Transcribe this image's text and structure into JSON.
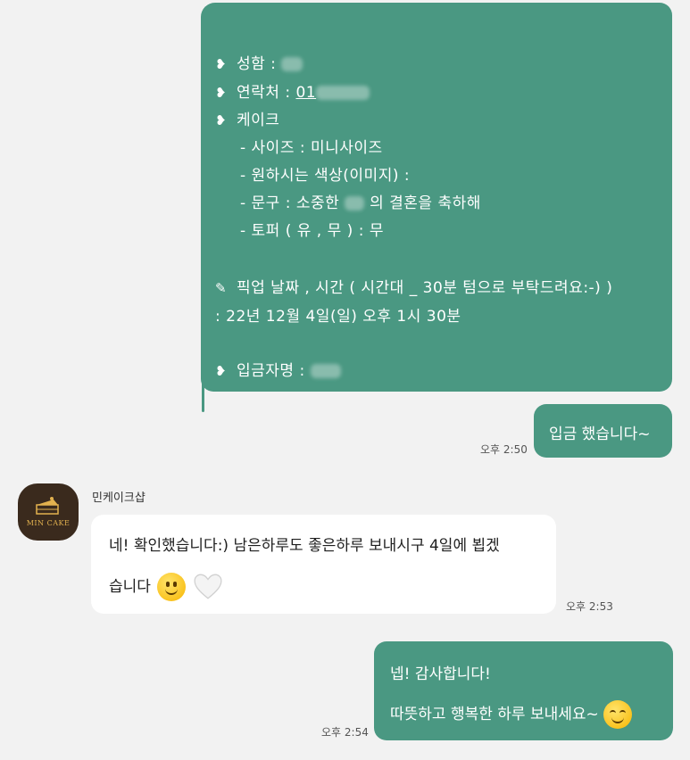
{
  "colors": {
    "outgoing_bubble": "#4a9882",
    "incoming_bubble": "#ffffff",
    "background": "#f2f2f2"
  },
  "order_form": {
    "name_label": "성함 :",
    "contact_label": "연락처 :",
    "contact_value": "01",
    "cake_label": "케이크",
    "size_line": "- 사이즈 : 미니사이즈",
    "color_line": "- 원하시는 색상(이미지) :",
    "text_line_prefix": "- 문구 : 소중한",
    "text_line_suffix": "의 결혼을 축하해",
    "topper_line": "- 토퍼 ( 유 , 무 ) : 무",
    "pickup_label": "픽업 날짜 , 시간 ( 시간대 _ 30분 텀으로 부탁드려요:-) )",
    "pickup_value": ": 22년 12월 4일(일) 오후 1시 30분",
    "depositor_label": "입금자명 :"
  },
  "messages": {
    "deposit": {
      "text": "입금 했습니다~",
      "time": "오후 2:50"
    },
    "reply": {
      "sender": "민케이크샵",
      "avatar_text": "MIN CAKE",
      "line1": "네! 확인했습니다:) 남은하루도 좋은하루 보내시구 4일에 뵙겠",
      "line2": "습니다",
      "time": "오후 2:53"
    },
    "thanks": {
      "line1": "넵! 감사합니다!",
      "line2": "따뜻하고 행복한 하루 보내세요~",
      "time": "오후 2:54"
    }
  },
  "icons": [
    "heart-bullet-icon",
    "pen-icon",
    "smile-emoji-icon",
    "white-heart-emoji-icon",
    "blush-emoji-icon",
    "cake-logo-icon"
  ]
}
